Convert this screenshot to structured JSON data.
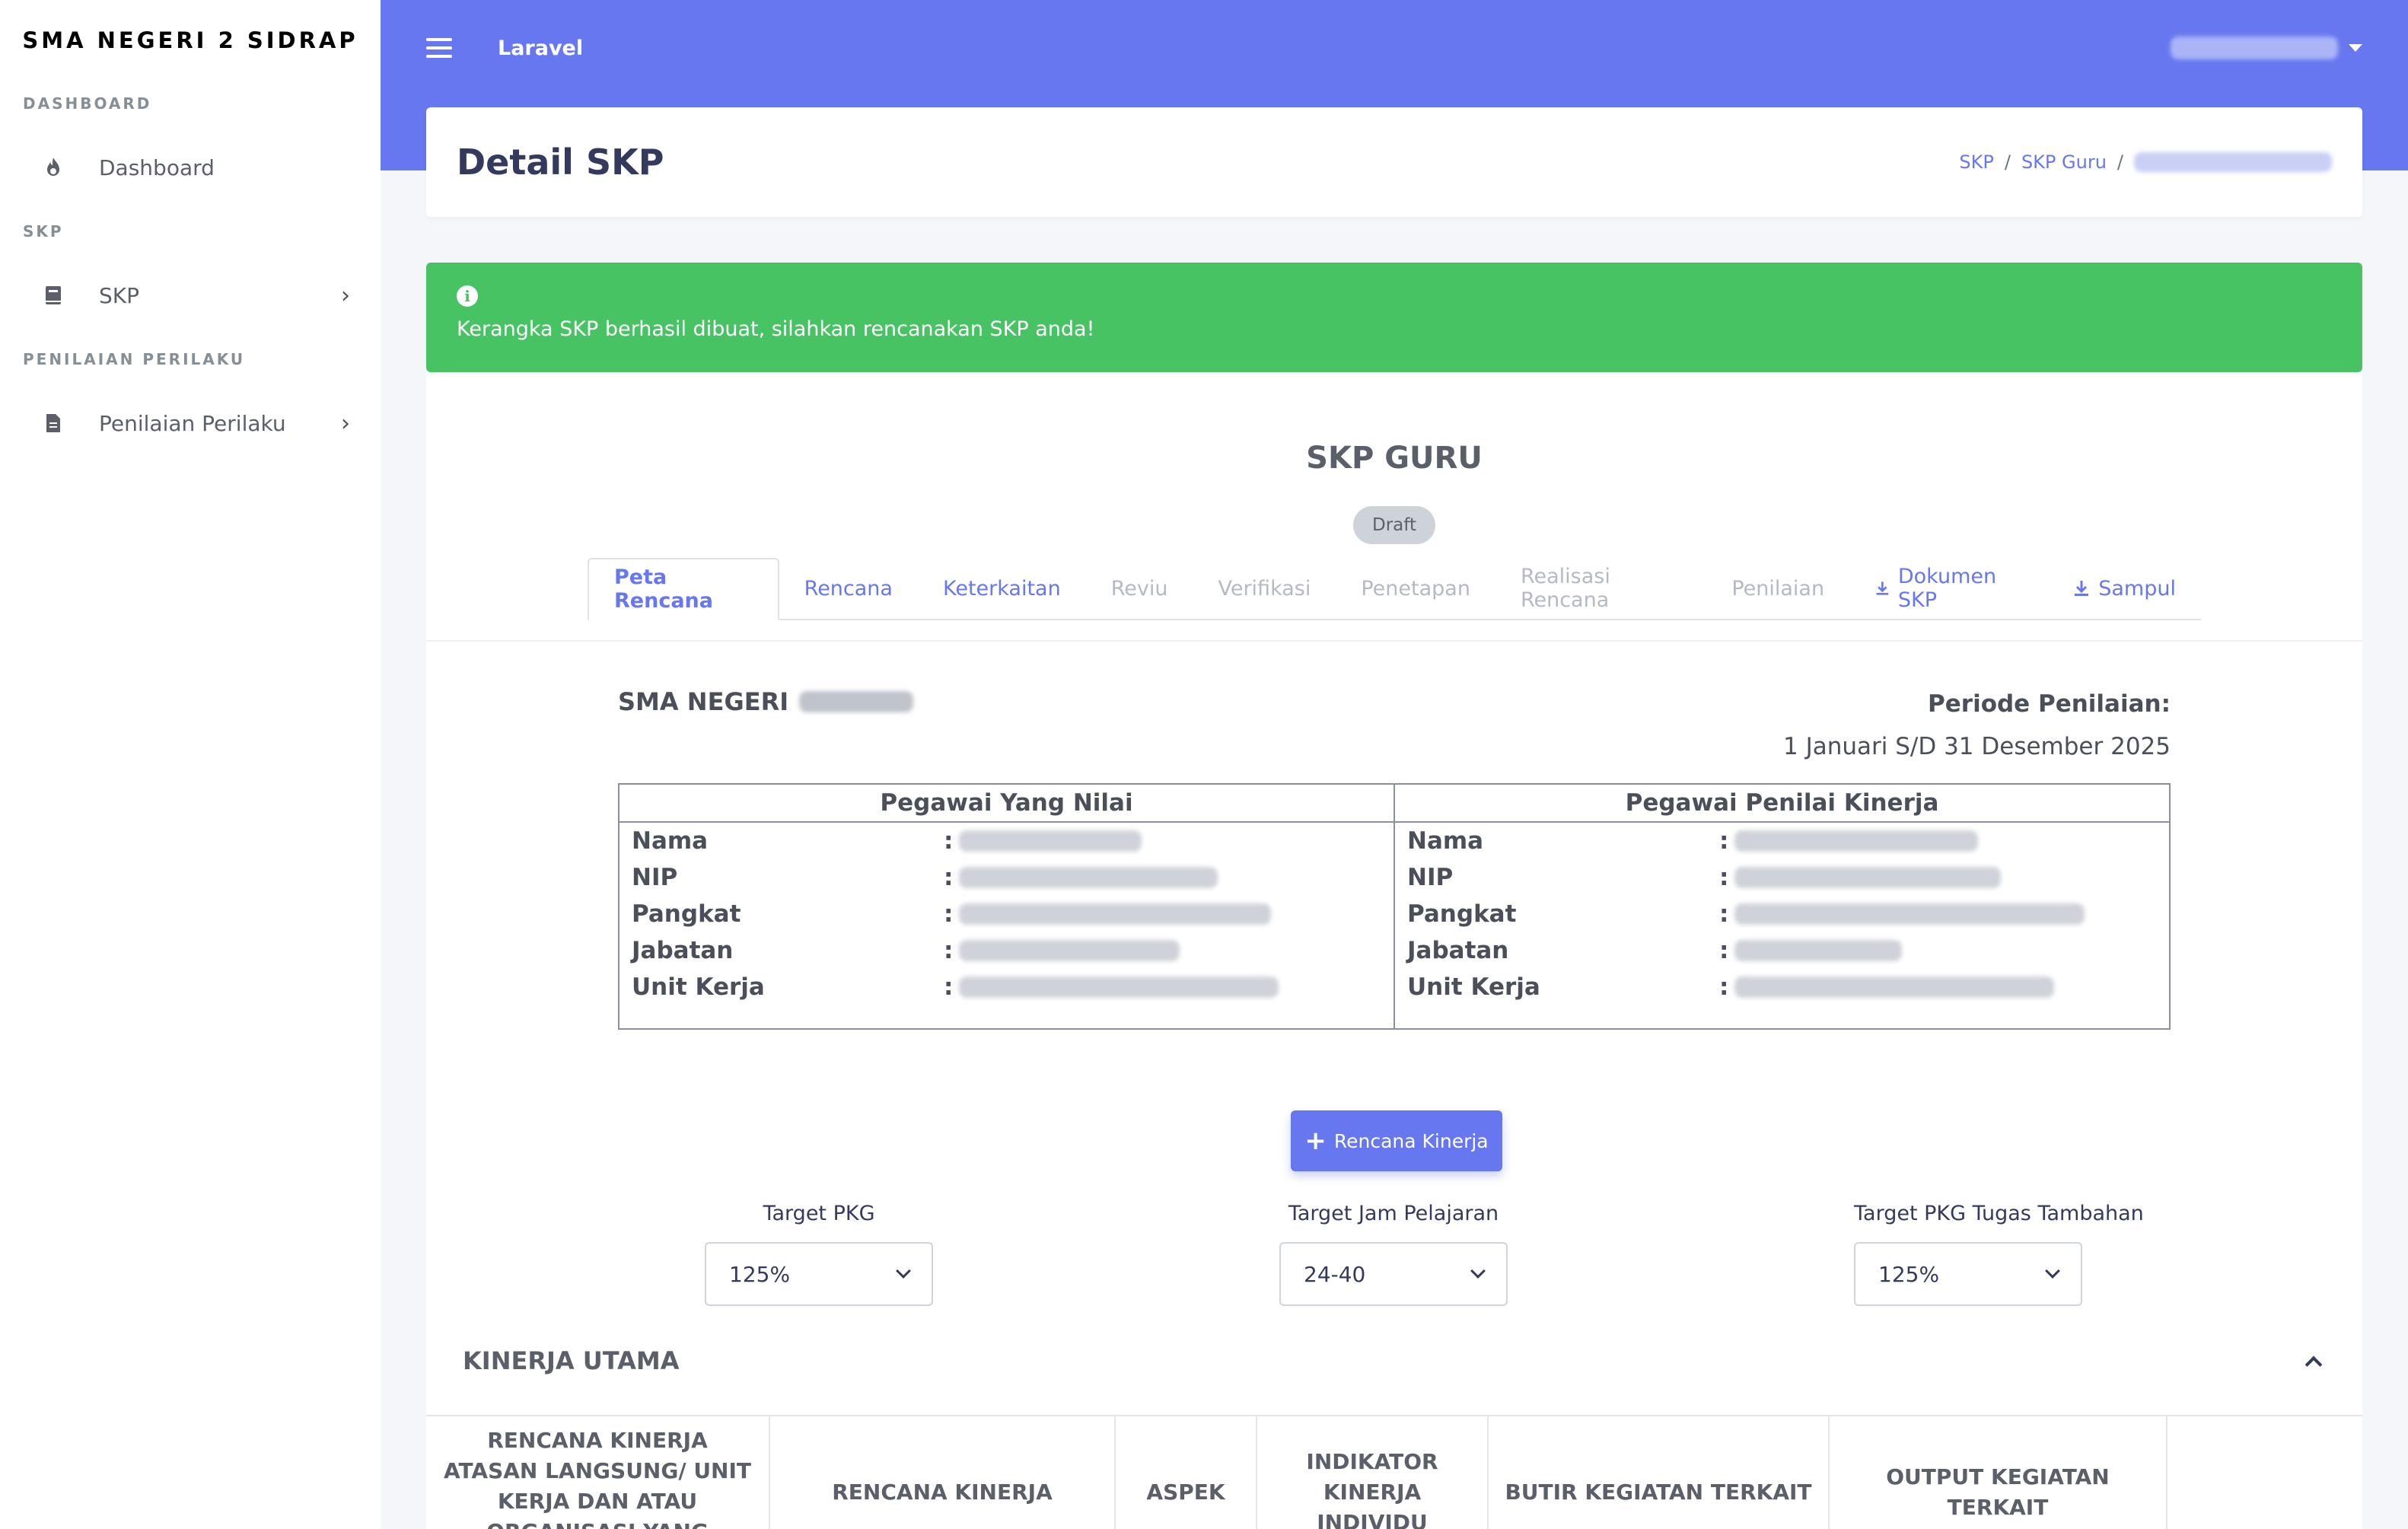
{
  "sidebar": {
    "brand": "SMA NEGERI 2 SIDRAP",
    "sections": [
      {
        "header": "DASHBOARD",
        "item": "Dashboard",
        "icon": "fire-icon"
      },
      {
        "header": "SKP",
        "item": "SKP",
        "icon": "book-icon"
      },
      {
        "header": "PENILAIAN PERILAKU",
        "item": "Penilaian Perilaku",
        "icon": "file-icon"
      }
    ]
  },
  "topbar": {
    "app_name": "Laravel",
    "accent": "#6777ef"
  },
  "header": {
    "title": "Detail SKP",
    "breadcrumb": [
      "SKP",
      "SKP Guru"
    ],
    "breadcrumb_sep": "/"
  },
  "alert": {
    "message": "Kerangka SKP berhasil dibuat, silahkan rencanakan SKP anda!",
    "color": "#47c363"
  },
  "card": {
    "title": "SKP GURU",
    "status": "Draft",
    "tabs": [
      {
        "label": "Peta Rencana",
        "state": "active"
      },
      {
        "label": "Rencana",
        "state": "enabled"
      },
      {
        "label": "Keterkaitan",
        "state": "enabled"
      },
      {
        "label": "Reviu",
        "state": "disabled"
      },
      {
        "label": "Verifikasi",
        "state": "disabled"
      },
      {
        "label": "Penetapan",
        "state": "disabled"
      },
      {
        "label": "Realisasi Rencana",
        "state": "disabled"
      },
      {
        "label": "Penilaian",
        "state": "disabled"
      },
      {
        "label": "Dokumen SKP",
        "state": "download"
      },
      {
        "label": "Sampul",
        "state": "download"
      }
    ],
    "org_name": "SMA NEGERI",
    "periode_label": "Periode Penilaian:",
    "periode_value": "1 Januari S/D 31 Desember 2025",
    "pegawai": {
      "left_title": "Pegawai Yang Nilai",
      "right_title": "Pegawai Penilai Kinerja",
      "fields": [
        "Nama",
        "NIP",
        "Pangkat",
        "Jabatan",
        "Unit Kerja"
      ],
      "colon": ":"
    },
    "add_button": "Rencana Kinerja",
    "targets": [
      {
        "label": "Target PKG",
        "value": "125%"
      },
      {
        "label": "Target Jam Pelajaran",
        "value": "24-40"
      },
      {
        "label": "Target PKG Tugas Tambahan",
        "value": "125%"
      }
    ],
    "kinerja_title": "KINERJA UTAMA",
    "kinerja_columns": [
      "RENCANA KINERJA ATASAN LANGSUNG/ UNIT KERJA DAN ATAU ORGANISASI YANG DIINTERVENSI",
      "RENCANA KINERJA",
      "ASPEK",
      "INDIKATOR KINERJA INDIVIDU",
      "BUTIR KEGIATAN TERKAIT",
      "OUTPUT KEGIATAN TERKAIT",
      ""
    ]
  }
}
